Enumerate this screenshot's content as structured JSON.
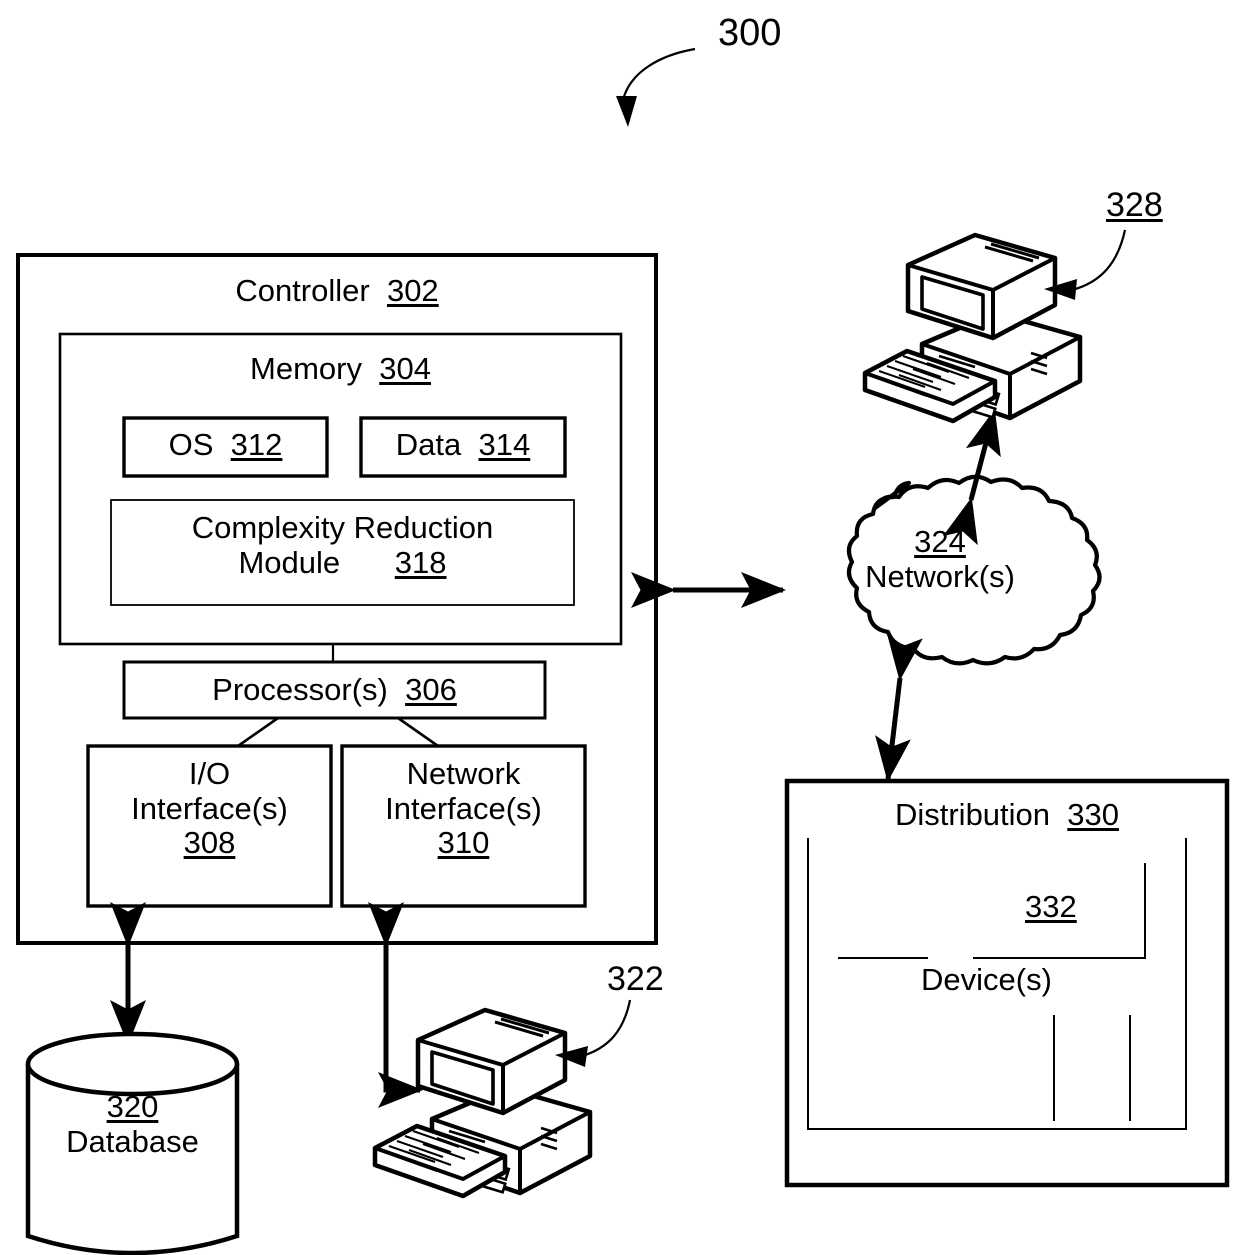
{
  "figure": {
    "number": "300"
  },
  "controller": {
    "title": "Controller",
    "ref": "302",
    "memory": {
      "title": "Memory",
      "ref": "304",
      "os": {
        "label": "OS",
        "ref": "312"
      },
      "data": {
        "label": "Data",
        "ref": "314"
      },
      "module": {
        "line1": "Complexity Reduction",
        "line2": "Module",
        "ref": "318"
      }
    },
    "processor": {
      "label": "Processor(s)",
      "ref": "306"
    },
    "io_interface": {
      "line1": "I/O",
      "line2": "Interface(s)",
      "ref": "308"
    },
    "network_interface": {
      "line1": "Network",
      "line2": "Interface(s)",
      "ref": "310"
    }
  },
  "database": {
    "ref": "320",
    "label": "Database"
  },
  "local_computer": {
    "ref": "322",
    "icon": "desktop-computer-icon"
  },
  "network_cloud": {
    "ref": "324",
    "label": "Network(s)",
    "icon": "cloud-icon"
  },
  "remote_computer": {
    "ref": "328",
    "icon": "desktop-computer-icon"
  },
  "distribution": {
    "title": "Distribution",
    "ref": "330",
    "devices": {
      "ref": "332",
      "label": "Device(s)"
    }
  },
  "connectors": [
    {
      "name": "controller-to-network",
      "type": "double-arrow"
    },
    {
      "name": "network-to-remote-computer",
      "type": "double-arrow"
    },
    {
      "name": "network-to-distribution",
      "type": "double-arrow"
    },
    {
      "name": "controller-to-database",
      "type": "double-arrow"
    },
    {
      "name": "controller-to-local-computer",
      "type": "double-arrow-elbow"
    },
    {
      "name": "figure-callout-300",
      "type": "curved-leader"
    },
    {
      "name": "callout-322",
      "type": "curved-leader"
    },
    {
      "name": "callout-328",
      "type": "curved-leader"
    }
  ],
  "colors": {
    "ink": "#000000",
    "paper": "#ffffff"
  }
}
